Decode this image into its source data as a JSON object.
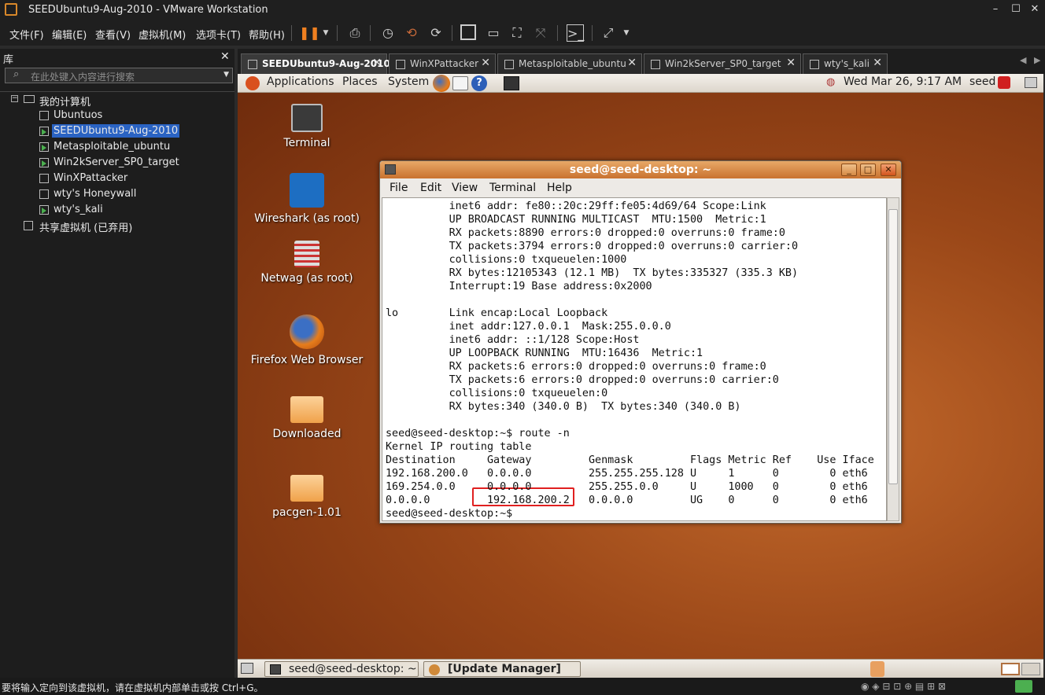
{
  "window": {
    "title": "SEEDUbuntu9-Aug-2010 - VMware Workstation",
    "min": "–",
    "max": "☐",
    "close": "✕"
  },
  "menu": [
    "文件(F)",
    "编辑(E)",
    "查看(V)",
    "虚拟机(M)",
    "选项卡(T)",
    "帮助(H)"
  ],
  "library": {
    "header": "库",
    "close": "✕",
    "search_placeholder": "在此处键入内容进行搜索",
    "root": "我的计算机",
    "vms": [
      "Ubuntuos",
      "SEEDUbuntu9-Aug-2010",
      "Metasploitable_ubuntu",
      "Win2kServer_SP0_target",
      "WinXPattacker",
      "wty's Honeywall",
      "wty's_kali"
    ],
    "shared": "共享虚拟机 (已弃用)"
  },
  "tabs": [
    "SEEDUbuntu9-Aug-2010",
    "WinXPattacker",
    "Metasploitable_ubuntu",
    "Win2kServer_SP0_target",
    "wty's_kali"
  ],
  "gnome": {
    "applications": "Applications",
    "places": "Places",
    "system": "System",
    "clock": "Wed Mar 26,  9:17 AM",
    "user": "seed"
  },
  "desktop": [
    "Terminal",
    "Wireshark (as root)",
    "Netwag (as root)",
    "Firefox Web Browser",
    "Downloaded",
    "pacgen-1.01"
  ],
  "terminal": {
    "title": "seed@seed-desktop: ~",
    "menu": [
      "File",
      "Edit",
      "View",
      "Terminal",
      "Help"
    ],
    "lines": [
      "          inet6 addr: fe80::20c:29ff:fe05:4d69/64 Scope:Link",
      "          UP BROADCAST RUNNING MULTICAST  MTU:1500  Metric:1",
      "          RX packets:8890 errors:0 dropped:0 overruns:0 frame:0",
      "          TX packets:3794 errors:0 dropped:0 overruns:0 carrier:0",
      "          collisions:0 txqueuelen:1000",
      "          RX bytes:12105343 (12.1 MB)  TX bytes:335327 (335.3 KB)",
      "          Interrupt:19 Base address:0x2000",
      "",
      "lo        Link encap:Local Loopback",
      "          inet addr:127.0.0.1  Mask:255.0.0.0",
      "          inet6 addr: ::1/128 Scope:Host",
      "          UP LOOPBACK RUNNING  MTU:16436  Metric:1",
      "          RX packets:6 errors:0 dropped:0 overruns:0 frame:0",
      "          TX packets:6 errors:0 dropped:0 overruns:0 carrier:0",
      "          collisions:0 txqueuelen:0",
      "          RX bytes:340 (340.0 B)  TX bytes:340 (340.0 B)",
      "",
      "seed@seed-desktop:~$ route -n",
      "Kernel IP routing table",
      "Destination     Gateway         Genmask         Flags Metric Ref    Use Iface",
      "192.168.200.0   0.0.0.0         255.255.255.128 U     1      0        0 eth6",
      "169.254.0.0     0.0.0.0         255.255.0.0     U     1000   0        0 eth6",
      "0.0.0.0         192.168.200.2   0.0.0.0         UG    0      0        0 eth6",
      "seed@seed-desktop:~$ "
    ]
  },
  "taskbar": {
    "terminal": "seed@seed-desktop: ~",
    "update": "[Update Manager]"
  },
  "status": "要将输入定向到该虚拟机，请在虚拟机内部单击或按 Ctrl+G。"
}
